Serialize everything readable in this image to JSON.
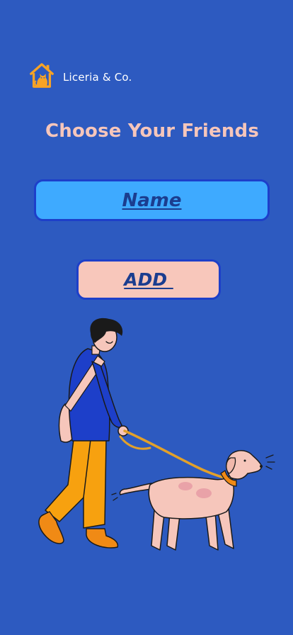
{
  "brand": {
    "name": "Liceria & Co.",
    "logo_icon": "house-with-cat-icon",
    "logo_color": "#f7a325"
  },
  "page": {
    "title": "Choose Your Friends",
    "background_color": "#2d5ac0",
    "title_color": "#f6c6bb"
  },
  "name_field": {
    "value": "Name",
    "background_color": "#3eaaff"
  },
  "add_button": {
    "label": "ADD ",
    "background_color": "#f8c7bb"
  },
  "illustration": {
    "icon": "person-walking-dog-illustration"
  }
}
